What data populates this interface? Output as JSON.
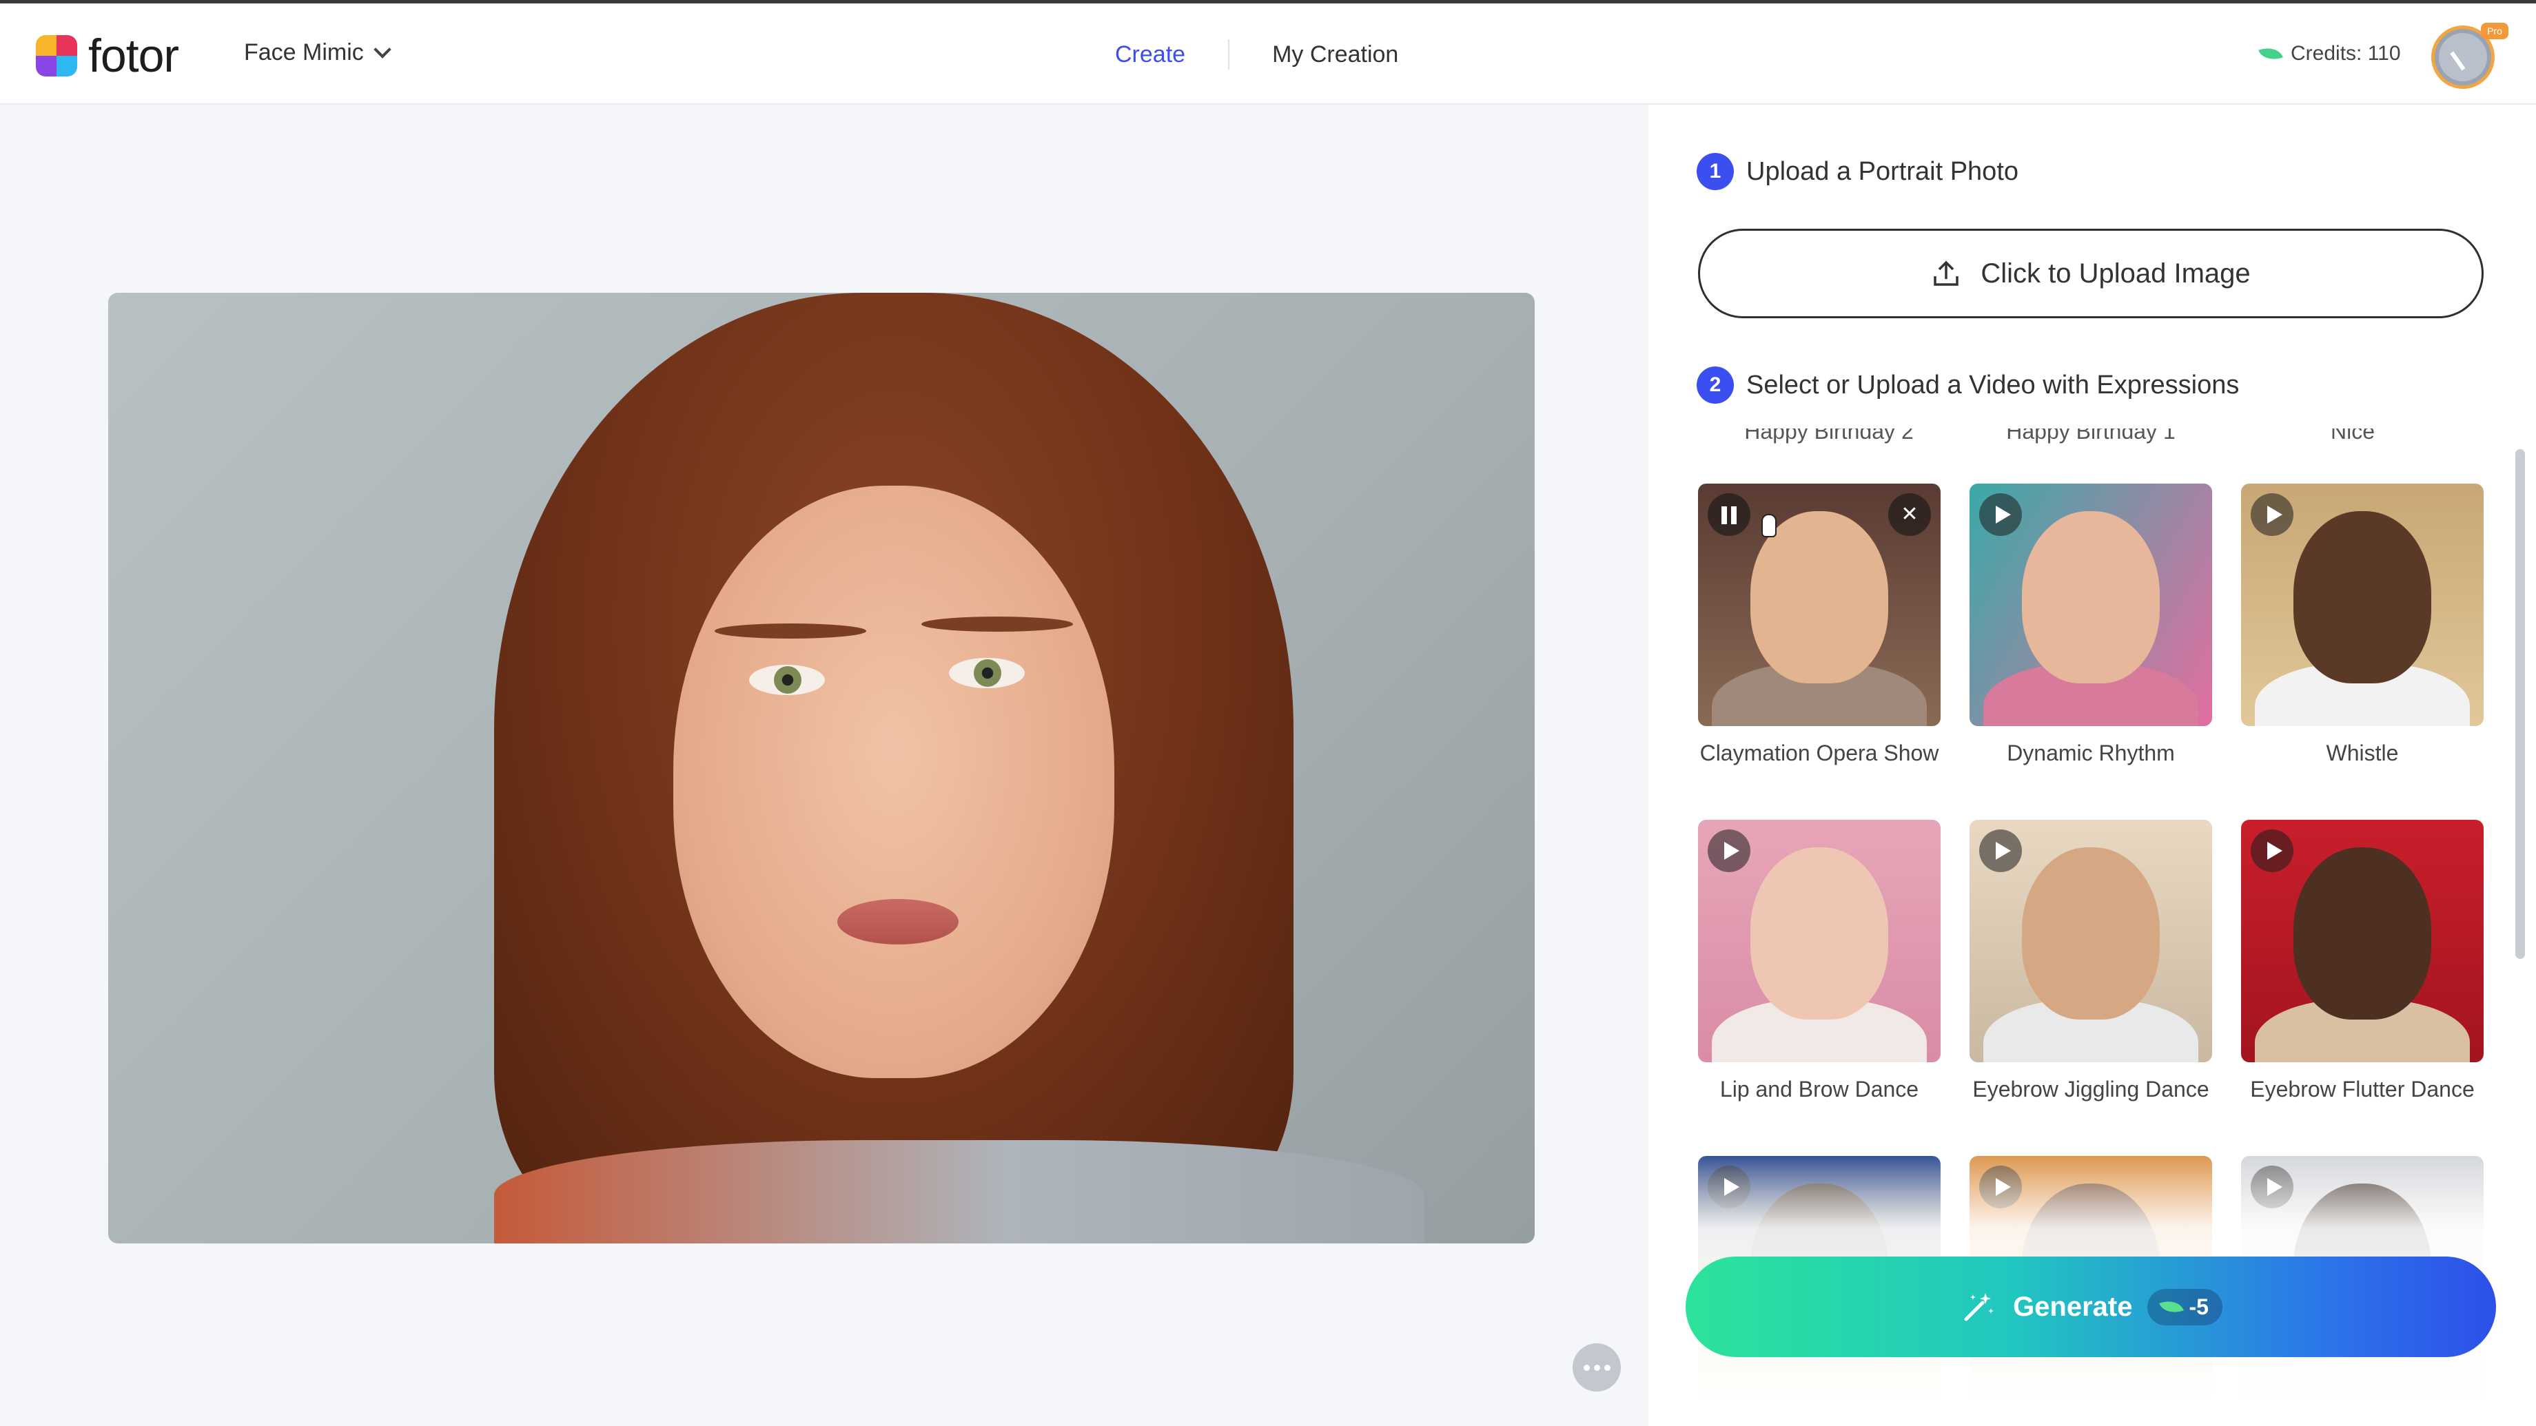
{
  "header": {
    "brand": "fotor",
    "tool_name": "Face Mimic",
    "nav": [
      {
        "label": "Create",
        "active": true
      },
      {
        "label": "My Creation",
        "active": false
      }
    ],
    "credits": "Credits: 110",
    "pro_badge": "Pro"
  },
  "steps": [
    {
      "number": "1",
      "title": "Upload a Portrait Photo"
    },
    {
      "number": "2",
      "title": "Select or Upload a Video with Expressions"
    }
  ],
  "upload_button": "Click to Upload Image",
  "previous_row_labels": [
    "Happy Birthday 2",
    "Happy Birthday 1",
    "Nice"
  ],
  "templates": [
    {
      "label": "Claymation Opera Show",
      "state": "playing",
      "icon": "pause-icon"
    },
    {
      "label": "Dynamic Rhythm",
      "state": "paused",
      "icon": "play-icon"
    },
    {
      "label": "Whistle",
      "state": "paused",
      "icon": "play-icon"
    },
    {
      "label": "Lip and Brow Dance",
      "state": "paused",
      "icon": "play-icon"
    },
    {
      "label": "Eyebrow Jiggling Dance",
      "state": "paused",
      "icon": "play-icon"
    },
    {
      "label": "Eyebrow Flutter Dance",
      "state": "paused",
      "icon": "play-icon"
    }
  ],
  "generate": {
    "label": "Generate",
    "cost": "-5"
  },
  "colors": {
    "accent": "#3b4ef0",
    "generate_start": "#2ce39a",
    "generate_end": "#2d50e8",
    "credit_leaf": "#43d18d"
  }
}
